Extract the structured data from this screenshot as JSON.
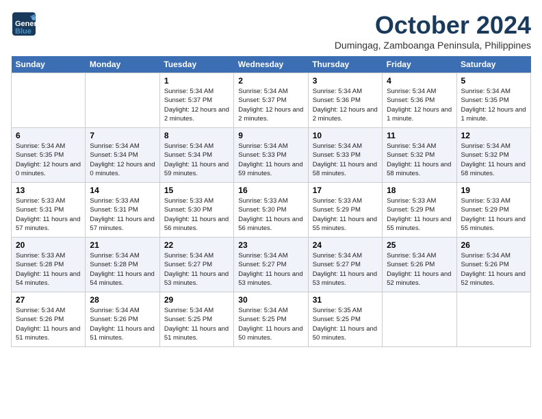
{
  "header": {
    "logo_line1": "General",
    "logo_line2": "Blue",
    "month_title": "October 2024",
    "subtitle": "Dumingag, Zamboanga Peninsula, Philippines"
  },
  "days_of_week": [
    "Sunday",
    "Monday",
    "Tuesday",
    "Wednesday",
    "Thursday",
    "Friday",
    "Saturday"
  ],
  "weeks": [
    [
      {
        "day": "",
        "info": ""
      },
      {
        "day": "",
        "info": ""
      },
      {
        "day": "1",
        "info": "Sunrise: 5:34 AM\nSunset: 5:37 PM\nDaylight: 12 hours and 2 minutes."
      },
      {
        "day": "2",
        "info": "Sunrise: 5:34 AM\nSunset: 5:37 PM\nDaylight: 12 hours and 2 minutes."
      },
      {
        "day": "3",
        "info": "Sunrise: 5:34 AM\nSunset: 5:36 PM\nDaylight: 12 hours and 2 minutes."
      },
      {
        "day": "4",
        "info": "Sunrise: 5:34 AM\nSunset: 5:36 PM\nDaylight: 12 hours and 1 minute."
      },
      {
        "day": "5",
        "info": "Sunrise: 5:34 AM\nSunset: 5:35 PM\nDaylight: 12 hours and 1 minute."
      }
    ],
    [
      {
        "day": "6",
        "info": "Sunrise: 5:34 AM\nSunset: 5:35 PM\nDaylight: 12 hours and 0 minutes."
      },
      {
        "day": "7",
        "info": "Sunrise: 5:34 AM\nSunset: 5:34 PM\nDaylight: 12 hours and 0 minutes."
      },
      {
        "day": "8",
        "info": "Sunrise: 5:34 AM\nSunset: 5:34 PM\nDaylight: 11 hours and 59 minutes."
      },
      {
        "day": "9",
        "info": "Sunrise: 5:34 AM\nSunset: 5:33 PM\nDaylight: 11 hours and 59 minutes."
      },
      {
        "day": "10",
        "info": "Sunrise: 5:34 AM\nSunset: 5:33 PM\nDaylight: 11 hours and 58 minutes."
      },
      {
        "day": "11",
        "info": "Sunrise: 5:34 AM\nSunset: 5:32 PM\nDaylight: 11 hours and 58 minutes."
      },
      {
        "day": "12",
        "info": "Sunrise: 5:34 AM\nSunset: 5:32 PM\nDaylight: 11 hours and 58 minutes."
      }
    ],
    [
      {
        "day": "13",
        "info": "Sunrise: 5:33 AM\nSunset: 5:31 PM\nDaylight: 11 hours and 57 minutes."
      },
      {
        "day": "14",
        "info": "Sunrise: 5:33 AM\nSunset: 5:31 PM\nDaylight: 11 hours and 57 minutes."
      },
      {
        "day": "15",
        "info": "Sunrise: 5:33 AM\nSunset: 5:30 PM\nDaylight: 11 hours and 56 minutes."
      },
      {
        "day": "16",
        "info": "Sunrise: 5:33 AM\nSunset: 5:30 PM\nDaylight: 11 hours and 56 minutes."
      },
      {
        "day": "17",
        "info": "Sunrise: 5:33 AM\nSunset: 5:29 PM\nDaylight: 11 hours and 55 minutes."
      },
      {
        "day": "18",
        "info": "Sunrise: 5:33 AM\nSunset: 5:29 PM\nDaylight: 11 hours and 55 minutes."
      },
      {
        "day": "19",
        "info": "Sunrise: 5:33 AM\nSunset: 5:29 PM\nDaylight: 11 hours and 55 minutes."
      }
    ],
    [
      {
        "day": "20",
        "info": "Sunrise: 5:33 AM\nSunset: 5:28 PM\nDaylight: 11 hours and 54 minutes."
      },
      {
        "day": "21",
        "info": "Sunrise: 5:34 AM\nSunset: 5:28 PM\nDaylight: 11 hours and 54 minutes."
      },
      {
        "day": "22",
        "info": "Sunrise: 5:34 AM\nSunset: 5:27 PM\nDaylight: 11 hours and 53 minutes."
      },
      {
        "day": "23",
        "info": "Sunrise: 5:34 AM\nSunset: 5:27 PM\nDaylight: 11 hours and 53 minutes."
      },
      {
        "day": "24",
        "info": "Sunrise: 5:34 AM\nSunset: 5:27 PM\nDaylight: 11 hours and 53 minutes."
      },
      {
        "day": "25",
        "info": "Sunrise: 5:34 AM\nSunset: 5:26 PM\nDaylight: 11 hours and 52 minutes."
      },
      {
        "day": "26",
        "info": "Sunrise: 5:34 AM\nSunset: 5:26 PM\nDaylight: 11 hours and 52 minutes."
      }
    ],
    [
      {
        "day": "27",
        "info": "Sunrise: 5:34 AM\nSunset: 5:26 PM\nDaylight: 11 hours and 51 minutes."
      },
      {
        "day": "28",
        "info": "Sunrise: 5:34 AM\nSunset: 5:26 PM\nDaylight: 11 hours and 51 minutes."
      },
      {
        "day": "29",
        "info": "Sunrise: 5:34 AM\nSunset: 5:25 PM\nDaylight: 11 hours and 51 minutes."
      },
      {
        "day": "30",
        "info": "Sunrise: 5:34 AM\nSunset: 5:25 PM\nDaylight: 11 hours and 50 minutes."
      },
      {
        "day": "31",
        "info": "Sunrise: 5:35 AM\nSunset: 5:25 PM\nDaylight: 11 hours and 50 minutes."
      },
      {
        "day": "",
        "info": ""
      },
      {
        "day": "",
        "info": ""
      }
    ]
  ]
}
